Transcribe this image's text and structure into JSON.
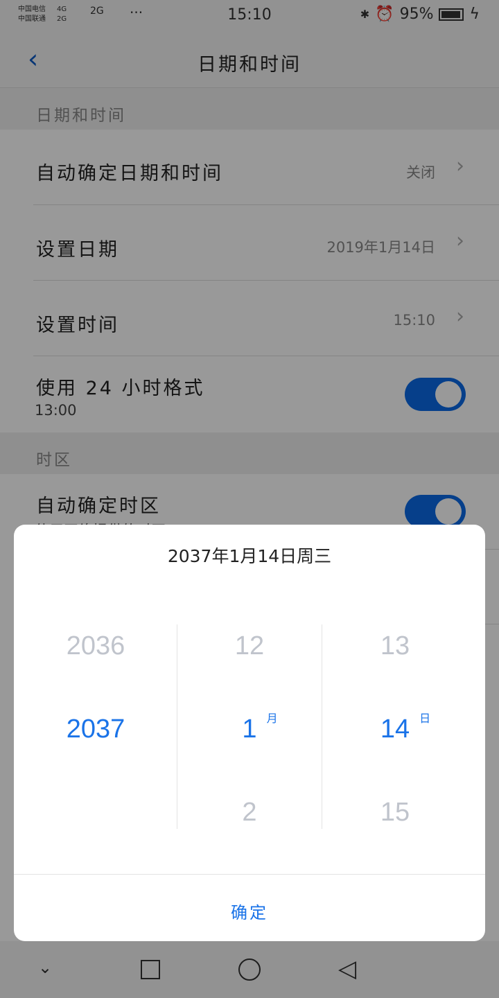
{
  "status": {
    "carrier1": "中国电信",
    "carrier2": "中国联通",
    "sig1": "4G",
    "sig2": "2G",
    "sig3": "2G",
    "time": "15:10",
    "battery": "95%",
    "battery_level": 95
  },
  "header": {
    "title": "日期和时间"
  },
  "sections": {
    "datetime": "日期和时间",
    "timezone": "时区"
  },
  "rows": {
    "auto_datetime": {
      "label": "自动确定日期和时间",
      "value": "关闭"
    },
    "set_date": {
      "label": "设置日期",
      "value": "2019年1月14日"
    },
    "set_time": {
      "label": "设置时间",
      "value": "15:10"
    },
    "use24": {
      "label": "使用 24 小时格式",
      "sub": "13:00",
      "on": true
    },
    "auto_tz": {
      "label": "自动确定时区",
      "sub": "使用网络提供的时区",
      "on": true
    }
  },
  "dialog": {
    "title": "2037年1月14日周三",
    "year": {
      "prev": "2036",
      "selected": "2037",
      "next": ""
    },
    "month": {
      "prev": "12",
      "selected": "1",
      "next": "2",
      "unit": "月"
    },
    "day": {
      "prev": "13",
      "selected": "14",
      "next": "15",
      "unit": "日"
    },
    "confirm": "确定"
  },
  "colors": {
    "accent": "#1a73e8",
    "toggle": "#0a6ae6"
  }
}
